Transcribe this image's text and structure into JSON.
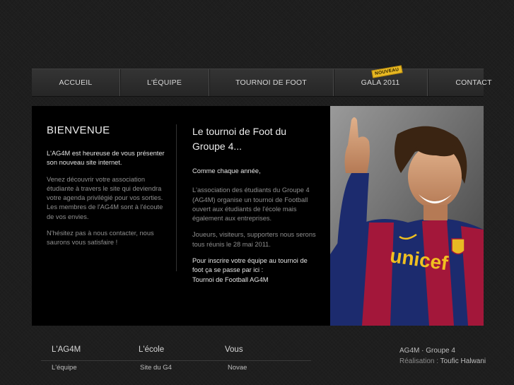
{
  "nav": {
    "items": [
      "ACCUEIL",
      "L'ÉQUIPE",
      "TOURNOI DE FOOT",
      "GALA 2011",
      "CONTACT"
    ],
    "badge": "NOUVEAU"
  },
  "welcome": {
    "title": "BIENVENUE",
    "intro": "L'AG4M est heureuse de vous présenter son nouveau site internet.",
    "p2": "Venez découvrir votre association étudiante à travers le site qui deviendra votre agenda privilégié pour vos sorties.",
    "p2b": "Les membres de l'AG4M sont à l'écoute de vos envies.",
    "p3": "N'hésitez pas à nous contacter, nous saurons vous satisfaire !"
  },
  "tournament": {
    "title": "Le tournoi de Foot du Groupe 4...",
    "lead": "Comme chaque année,",
    "p1": "L'association des étudiants du Groupe 4 (AG4M) organise un tournoi de Football ouvert aux étudiants de l'école mais également aux entreprises.",
    "p2": "Joueurs, visiteurs, supporters nous serons tous réunis le 28 mai 2011.",
    "p3": "Pour inscrire votre équipe au tournoi de foot ça se passe par ici :",
    "link": "Tournoi de Football AG4M"
  },
  "photo": {
    "shirt_text": "unicef"
  },
  "footer": {
    "cols": [
      {
        "title": "L'AG4M",
        "link": "L'équipe"
      },
      {
        "title": "L'école",
        "link": "Site du G4"
      },
      {
        "title": "Vous",
        "link": "Novae"
      }
    ],
    "credit_line": "AG4M  ·  Groupe 4",
    "credit_label": "Réalisation :",
    "credit_author": "Toufic Halwani"
  }
}
